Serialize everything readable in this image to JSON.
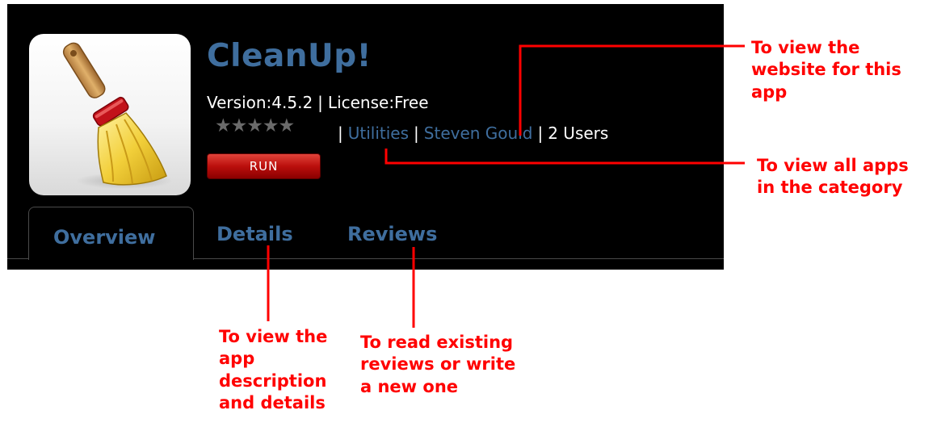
{
  "app": {
    "title": "CleanUp!",
    "version_label": "Version:4.5.2",
    "license_label": "License:Free",
    "rating": {
      "stars_total": 5,
      "stars_filled": 0
    },
    "category_link": "Utilities",
    "author_link": "Steven Gould",
    "users_count": "2 Users",
    "run_label": "RUN",
    "separator": "|",
    "star_glyph": "★",
    "icon": "broom-icon"
  },
  "tabs": [
    {
      "label": "Overview",
      "active": true
    },
    {
      "label": "Details",
      "active": false
    },
    {
      "label": "Reviews",
      "active": false
    }
  ],
  "callouts": {
    "website": [
      "To view the",
      "website for this",
      "app"
    ],
    "category": [
      "To view all apps",
      "in the category"
    ],
    "details": [
      "To view the",
      "app",
      "description",
      "and details"
    ],
    "reviews": [
      "To read existing",
      "reviews or write",
      "a new one"
    ]
  },
  "colors": {
    "panel_bg": "#000000",
    "link_blue": "#3f6e9e",
    "annotation_red": "#ff0000",
    "run_red": "#bb0f0c",
    "star_grey": "#6a6a6a"
  }
}
